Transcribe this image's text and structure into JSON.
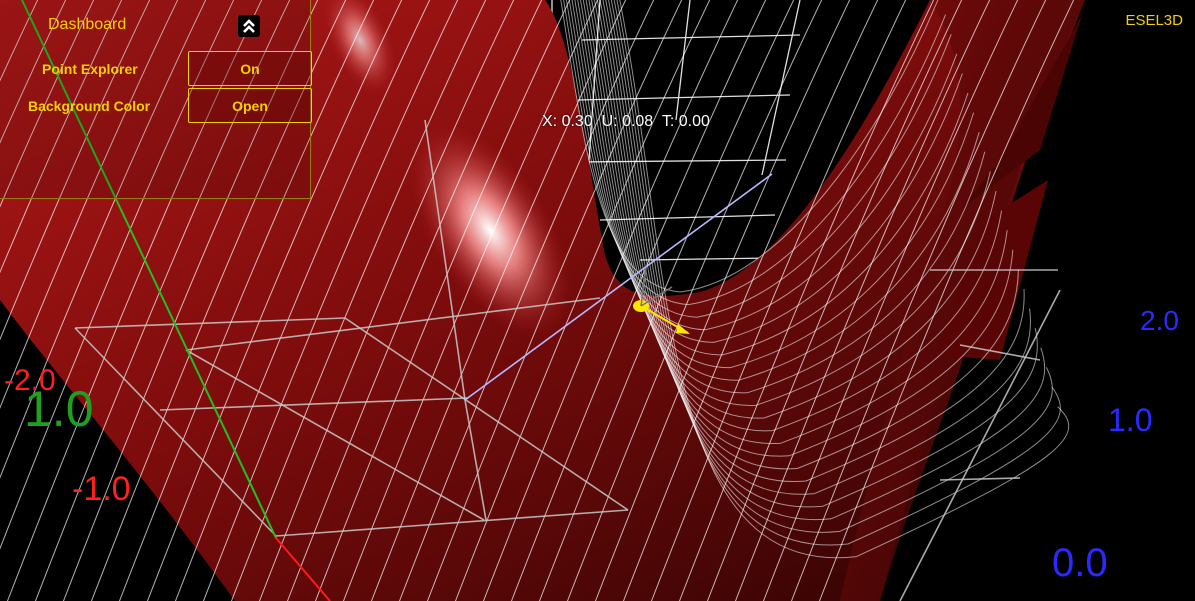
{
  "dashboard": {
    "title": "Dashboard",
    "collapse_icon": "double-chevron-up-icon",
    "rows": [
      {
        "label": "Point Explorer",
        "button": "On"
      },
      {
        "label": "Background Color",
        "button": "Open"
      }
    ]
  },
  "brand": "ESEL3D",
  "readout": {
    "x_label": "X:",
    "x": "0.30",
    "u_label": "U:",
    "u": "0.08",
    "t_label": "T:",
    "t": "0.00"
  },
  "axes": {
    "red": [
      "-2.0",
      "-1.0"
    ],
    "green": [
      "1.0"
    ],
    "blue": [
      "2.0",
      "1.0",
      "0.0"
    ]
  },
  "colors": {
    "accent": "#f4d000",
    "surface": "#7a0a0a",
    "axis_x": "#ff2020",
    "axis_y": "#1fb01f",
    "axis_z": "#2a2aff",
    "point": "#ffe600"
  }
}
